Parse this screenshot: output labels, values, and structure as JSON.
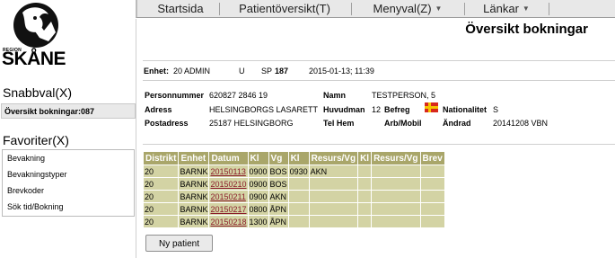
{
  "logo": {
    "region": "REGION",
    "name": "SKÅNE"
  },
  "sidebar": {
    "snabbval_label": "Snabbval(X)",
    "snabbval_selected": "Översikt bokningar:087",
    "favoriter_label": "Favoriter(X)",
    "favorites": [
      "Bevakning",
      "Bevakningstyper",
      "Brevkoder",
      "Sök tid/Bokning"
    ]
  },
  "menubar": {
    "items": [
      "Startsida",
      "Patientöversikt(T)",
      "Menyval(Z)",
      "Länkar"
    ],
    "arrow": "▼"
  },
  "page": {
    "title": "Översikt bokningar"
  },
  "unit": {
    "enhet_label": "Enhet:",
    "enhet_value": "20 ADMIN",
    "u": "U",
    "sp_label": "SP",
    "sp_value": "187",
    "datetime": "2015-01-13; 11:39"
  },
  "patient": {
    "personnummer_label": "Personnummer",
    "personnummer_value": "620827 2846  19",
    "namn_label": "Namn",
    "namn_value": "TESTPERSON, 5",
    "adress_label": "Adress",
    "adress_value": "HELSINGBORGS LASARETT",
    "huvudman_label": "Huvudman",
    "huvudman_value": "12",
    "befreg_label": "Befreg",
    "nationalitet_label": "Nationalitet",
    "nationalitet_value": "S",
    "postadress_label": "Postadress",
    "postadress_value": "25187  HELSINGBORG",
    "telhem_label": "Tel Hem",
    "arbmobil_label": "Arb/Mobil",
    "andrad_label": "Ändrad",
    "andrad_value": "20141208 VBN"
  },
  "bookings": {
    "columns": [
      "Distrikt",
      "Enhet",
      "Datum",
      "Kl",
      "Vg",
      "Kl",
      "Resurs/Vg",
      "Kl",
      "Resurs/Vg",
      "Brev"
    ],
    "rows": [
      [
        "20",
        "BARNK",
        "20150113",
        "0900",
        "BOS",
        "0930",
        "AKN",
        "",
        "",
        ""
      ],
      [
        "20",
        "BARNK",
        "20150210",
        "0900",
        "BOS",
        "",
        "",
        "",
        "",
        ""
      ],
      [
        "20",
        "BARNK",
        "20150211",
        "0900",
        "AKN",
        "",
        "",
        "",
        "",
        ""
      ],
      [
        "20",
        "BARNK",
        "20150217",
        "0800",
        "ÅPN",
        "",
        "",
        "",
        "",
        ""
      ],
      [
        "20",
        "BARNK",
        "20150218",
        "1300",
        "ÅPN",
        "",
        "",
        "",
        "",
        ""
      ]
    ]
  },
  "actions": {
    "ny_patient": "Ny patient"
  },
  "colors": {
    "header_bg": "#a9a66a",
    "row_bg": "#d3d3a4",
    "link": "#8b1d2b",
    "flag_red": "#d8281c",
    "flag_yellow": "#f5c400"
  }
}
